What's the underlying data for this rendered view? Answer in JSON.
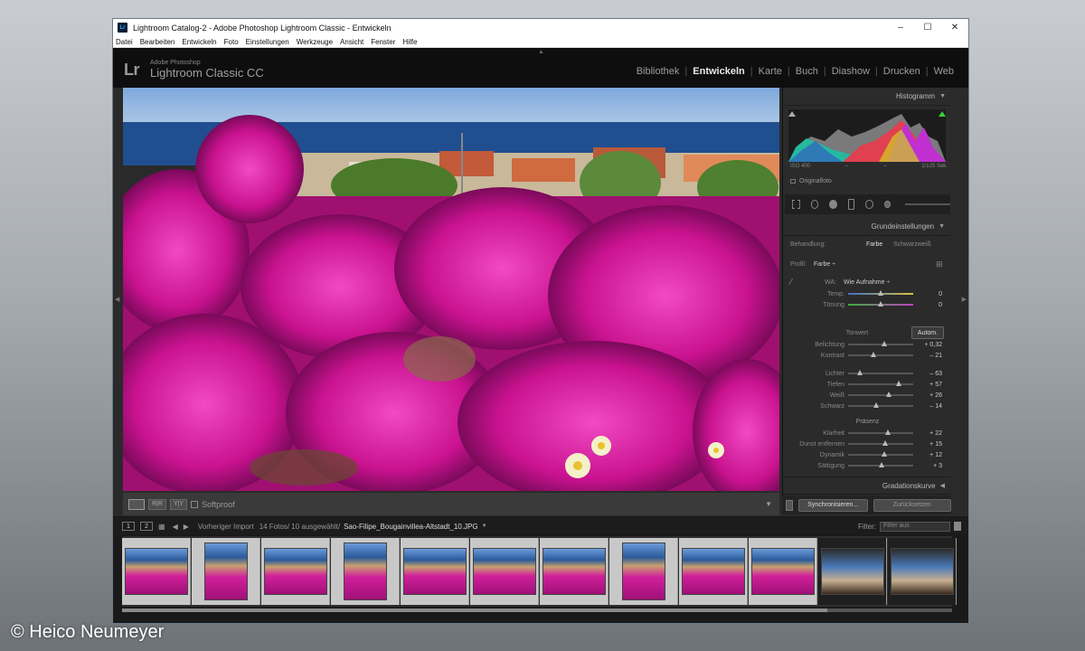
{
  "window": {
    "title": "Lightroom Catalog-2 - Adobe Photoshop Lightroom Classic - Entwickeln",
    "app_icon": "Lr",
    "controls": [
      "–",
      "☐",
      "✕"
    ]
  },
  "menu": [
    "Datei",
    "Bearbeiten",
    "Entwickeln",
    "Foto",
    "Einstellungen",
    "Werkzeuge",
    "Ansicht",
    "Fenster",
    "Hilfe"
  ],
  "identity": {
    "logo": "Lr",
    "vendor": "Adobe Photoshop",
    "product": "Lightroom Classic CC"
  },
  "modules": [
    {
      "label": "Bibliothek",
      "active": false
    },
    {
      "label": "Entwickeln",
      "active": true
    },
    {
      "label": "Karte",
      "active": false
    },
    {
      "label": "Buch",
      "active": false
    },
    {
      "label": "Diashow",
      "active": false
    },
    {
      "label": "Drucken",
      "active": false
    },
    {
      "label": "Web",
      "active": false
    }
  ],
  "toolbar": {
    "softproof_label": "Softproof",
    "view_buttons": [
      "R|R",
      "Y|Y"
    ]
  },
  "histogram": {
    "title": "Histogramm",
    "iso": "ISO 400",
    "dash1": "–",
    "dash2": "–",
    "shutter": "1/125 Sek.",
    "original_label": "Originalfoto"
  },
  "basic": {
    "title": "Grundeinstellungen",
    "treatment_label": "Behandlung:",
    "treatment_color": "Farbe",
    "treatment_bw": "Schwarzweiß",
    "profile_label": "Profil:",
    "profile_value": "Farbe ÷",
    "wb_label": "WA:",
    "wb_value": "Wie Aufnahme ÷",
    "temp": {
      "label": "Temp.",
      "value": "0",
      "pos": 0.5
    },
    "tint": {
      "label": "Tönung",
      "value": "0",
      "pos": 0.5
    },
    "tone_header": "Tonwert",
    "auto_label": "Autom.",
    "tone_sliders": [
      {
        "label": "Belichtung",
        "value": "+ 0,32",
        "pos": 0.55
      },
      {
        "label": "Kontrast",
        "value": "– 21",
        "pos": 0.39
      }
    ],
    "light_sliders": [
      {
        "label": "Lichter",
        "value": "– 63",
        "pos": 0.18
      },
      {
        "label": "Tiefen",
        "value": "+ 57",
        "pos": 0.78
      },
      {
        "label": "Weiß",
        "value": "+ 26",
        "pos": 0.63
      },
      {
        "label": "Schwarz",
        "value": "– 14",
        "pos": 0.43
      }
    ],
    "presence_header": "Präsenz",
    "presence_sliders": [
      {
        "label": "Klarheit",
        "value": "+ 22",
        "pos": 0.61
      },
      {
        "label": "Dunst entfernen",
        "value": "+ 15",
        "pos": 0.57
      },
      {
        "label": "Dynamik",
        "value": "+ 12",
        "pos": 0.56
      },
      {
        "label": "Sättigung",
        "value": "+ 3",
        "pos": 0.52
      }
    ]
  },
  "curve": {
    "title": "Gradationskurve"
  },
  "buttons": {
    "sync": "Synchronisieren...",
    "reset": "Zurücksetzen"
  },
  "filmbar": {
    "screen1": "1",
    "screen2": "2",
    "source": "Vorheriger Import",
    "count": "14 Fotos/ 10 ausgewählt/",
    "filename": "Sao-Filipe_Bougainvillea-Altstadt_10.JPG",
    "filter_label": "Filter:",
    "filter_value": "Filter aus"
  },
  "watermark": "© Heico Neumeyer",
  "colors": {
    "accent_active": "#e8e8e8",
    "panel_bg": "#2b2b2b",
    "magenta": "#d6189a"
  }
}
